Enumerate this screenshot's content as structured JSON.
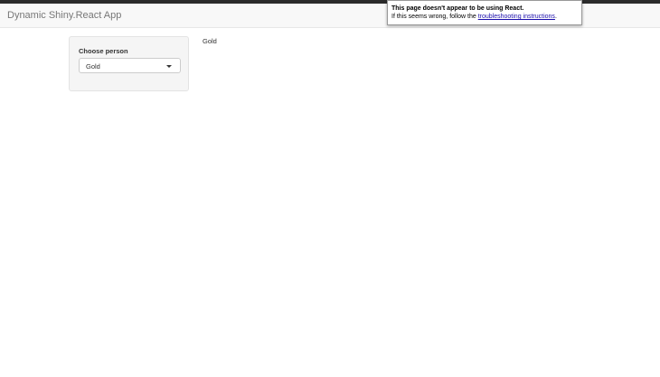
{
  "app": {
    "title": "Dynamic Shiny.React App"
  },
  "sidebar": {
    "select_label": "Choose person",
    "select_value": "Gold"
  },
  "main": {
    "output_text": "Gold"
  },
  "popup": {
    "title": "This page doesn't appear to be using React.",
    "body_prefix": "If this seems wrong, follow the ",
    "link_text": "troubleshooting instructions",
    "body_suffix": "."
  }
}
